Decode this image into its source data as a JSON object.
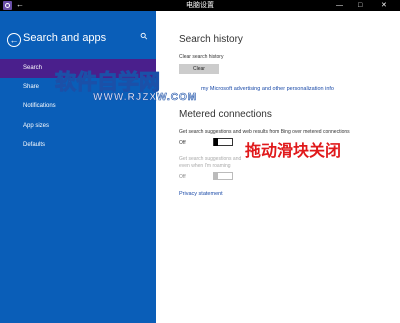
{
  "titlebar": {
    "menu_icon": "arrow-left",
    "title": "电脑设置",
    "minimize": "—",
    "maximize": "□",
    "close": "✕"
  },
  "sidebar": {
    "title": "Search and apps",
    "items": [
      {
        "label": "Search",
        "active": true
      },
      {
        "label": "Share",
        "active": false
      },
      {
        "label": "Notifications",
        "active": false
      },
      {
        "label": "App sizes",
        "active": false
      },
      {
        "label": "Defaults",
        "active": false
      }
    ]
  },
  "main": {
    "search_history_heading": "Search history",
    "clear_search_history_label": "Clear search history",
    "clear_button": "Clear",
    "personalization_link": "my Microsoft advertising and other personalization info",
    "metered_heading": "Metered connections",
    "suggestions_label": "Get search suggestions and web results from Bing over metered connections",
    "suggestions_state": "Off",
    "roaming_label_1": "Get search suggestions and",
    "roaming_label_2": "even when I'm roaming",
    "roaming_state": "Off",
    "privacy_link": "Privacy statement"
  },
  "overlay": {
    "watermark": "软件自学网",
    "watermark_url": "WWW.RJZXW.COM",
    "instruction": "拖动滑块关闭"
  },
  "colors": {
    "sidebar": "#0a5eb8",
    "active_item": "#4a1f8c",
    "link": "#1a4aa8",
    "instruction": "#e0191b"
  }
}
